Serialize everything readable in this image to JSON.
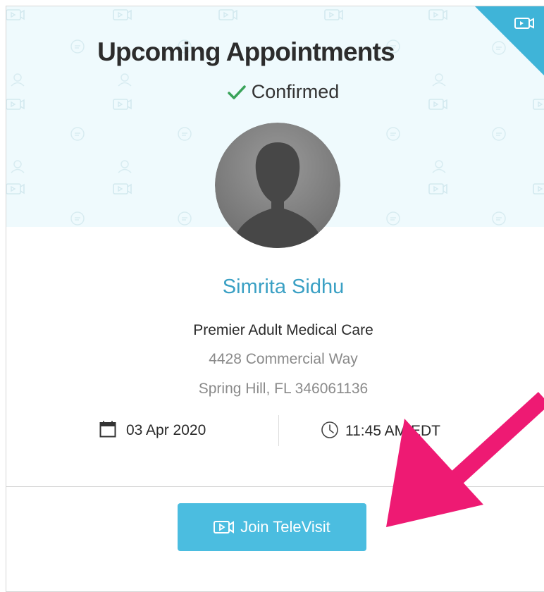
{
  "card": {
    "title": "Upcoming Appointments",
    "status_text": "Confirmed",
    "status_icon": "check-icon",
    "provider_name": "Simrita Sidhu",
    "practice_name": "Premier Adult Medical Care",
    "address_line1": "4428 Commercial Way",
    "address_line2": "Spring Hill, FL 346061136",
    "date": "03 Apr 2020",
    "date_icon": "calendar-icon",
    "time": "11:45 AM EDT",
    "time_icon": "clock-icon",
    "join_button_label": "Join TeleVisit",
    "join_button_icon": "video-camera-icon"
  },
  "colors": {
    "hero_background": "#effafd",
    "accent": "#4bbde0",
    "name_color": "#3aa0c4",
    "check_color": "#3aa35a",
    "annotation_arrow": "#ee1a73"
  }
}
